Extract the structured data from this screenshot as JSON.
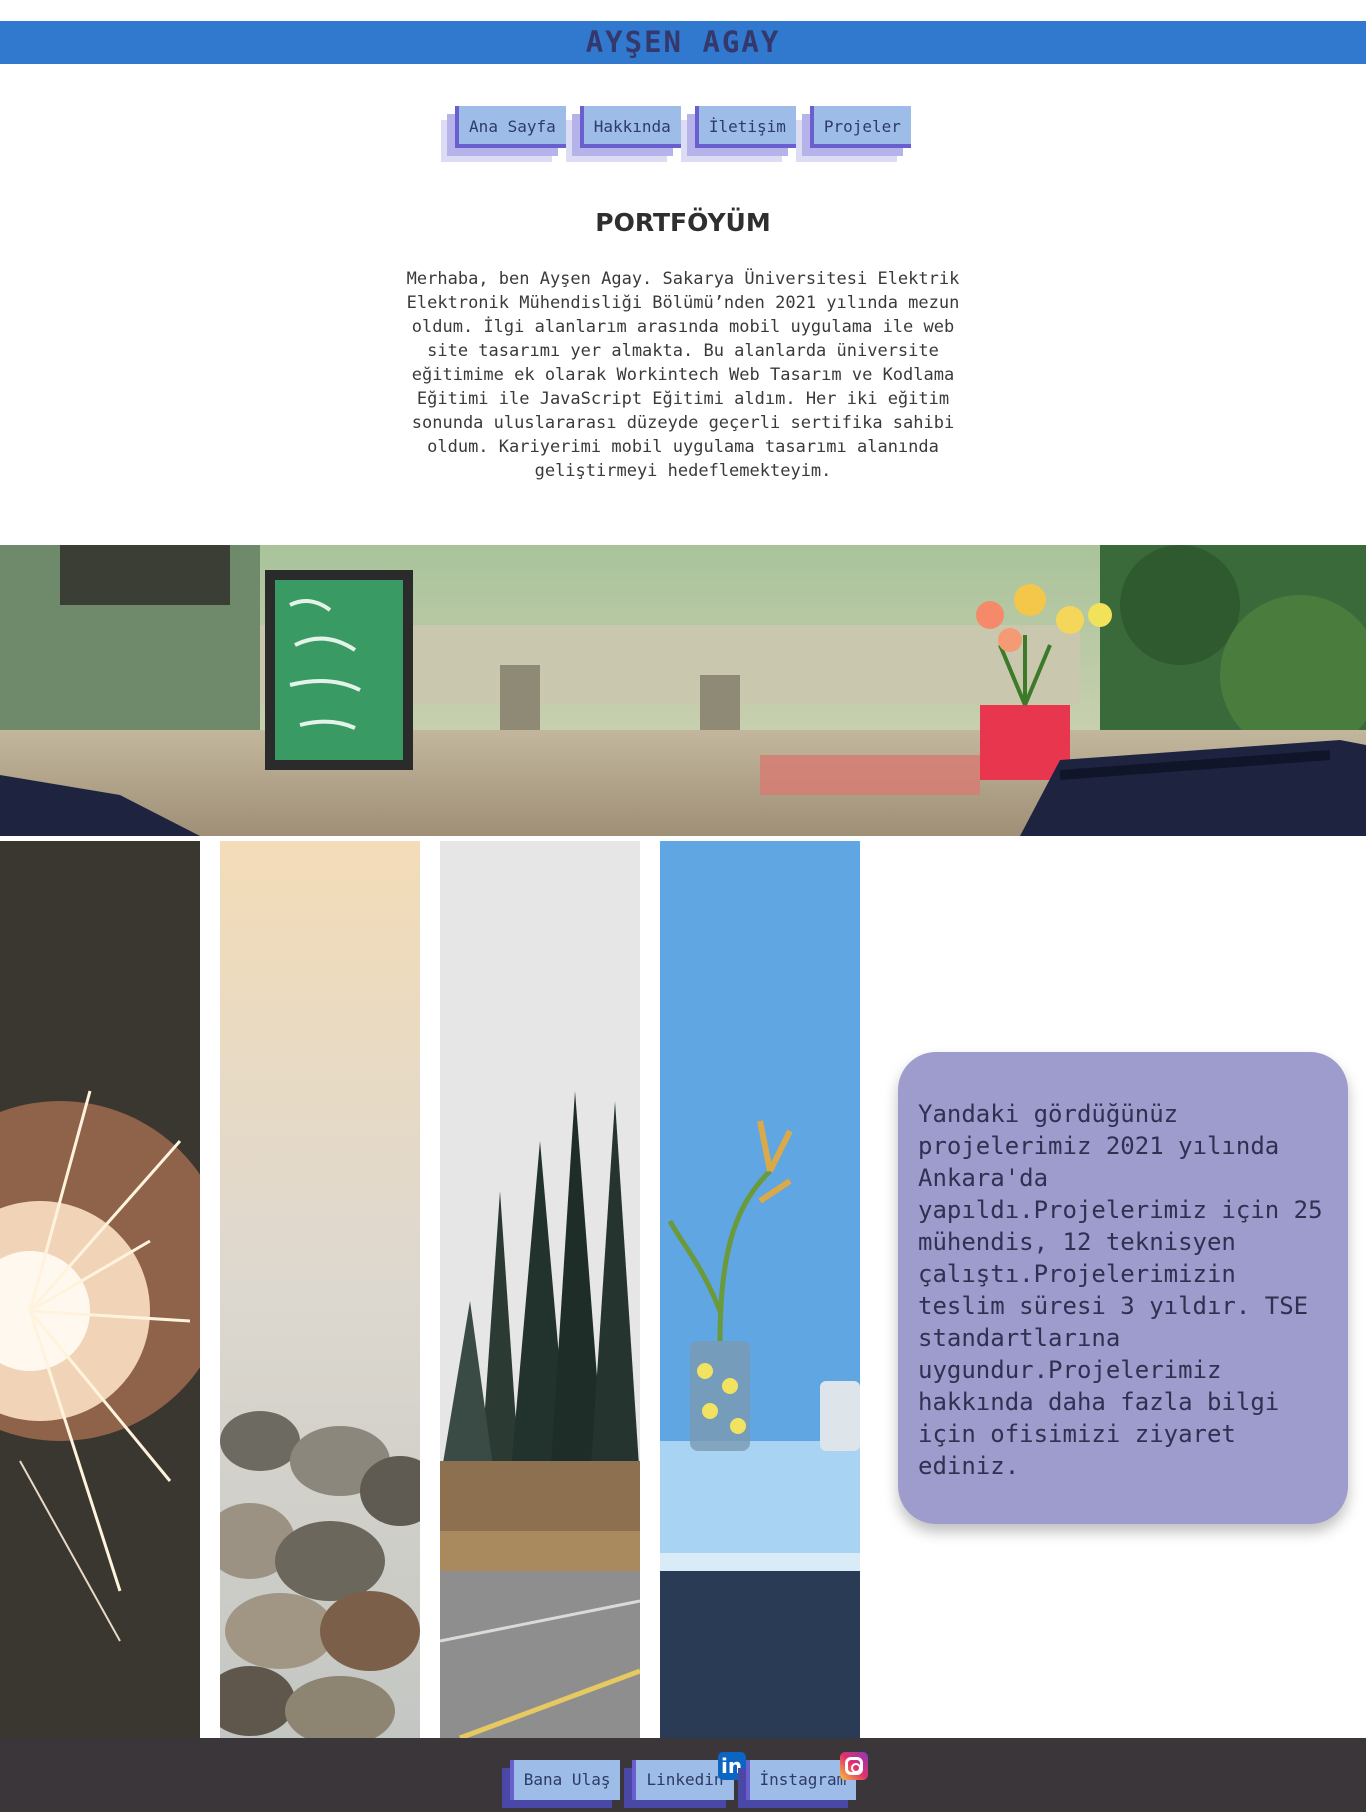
{
  "header": {
    "title": "AYŞEN AGAY"
  },
  "nav": [
    {
      "label": "Ana Sayfa"
    },
    {
      "label": "Hakkında"
    },
    {
      "label": "İletişim"
    },
    {
      "label": "Projeler"
    }
  ],
  "main": {
    "title": "PORTFÖYÜM",
    "intro": "Merhaba, ben Ayşen Agay. Sakarya Üniversitesi Elektrik Elektronik Mühendisliği Bölümü’nden 2021 yılında mezun oldum. İlgi alanlarım arasında mobil uygulama ile web site tasarımı yer almakta. Bu alanlarda üniversite eğitimime ek olarak Workintech Web Tasarım ve Kodlama Eğitimi ile JavaScript Eğitimi aldım. Her iki eğitim sonunda uluslararası düzeyde geçerli sertifika sahibi oldum. Kariyerimi mobil uygulama tasarımı alanında geliştirmeyi hedeflemekteyim."
  },
  "info_card": {
    "text": "Yandaki gördüğünüz projelerimiz 2021 yılında Ankara'da yapıldı.Projelerimiz için 25 mühendis, 12 teknisyen çalıştı.Projelerimizin teslim süresi 3 yıldır. TSE standartlarına uygundur.Projelerimiz hakkında daha fazla bilgi için ofisimizi ziyaret ediniz."
  },
  "footer": {
    "contact_label": "Bana Ulaş",
    "linkedin_label": "Linkedin",
    "instagram_label": "İnstagram",
    "linkedin_icon_text": "in"
  },
  "colors": {
    "header_bar": "#3178cf",
    "nav_button": "#9dbde8",
    "card": "#9e9ccc",
    "footer": "#3b3639"
  },
  "icons": [
    "linkedin-icon",
    "instagram-icon"
  ]
}
